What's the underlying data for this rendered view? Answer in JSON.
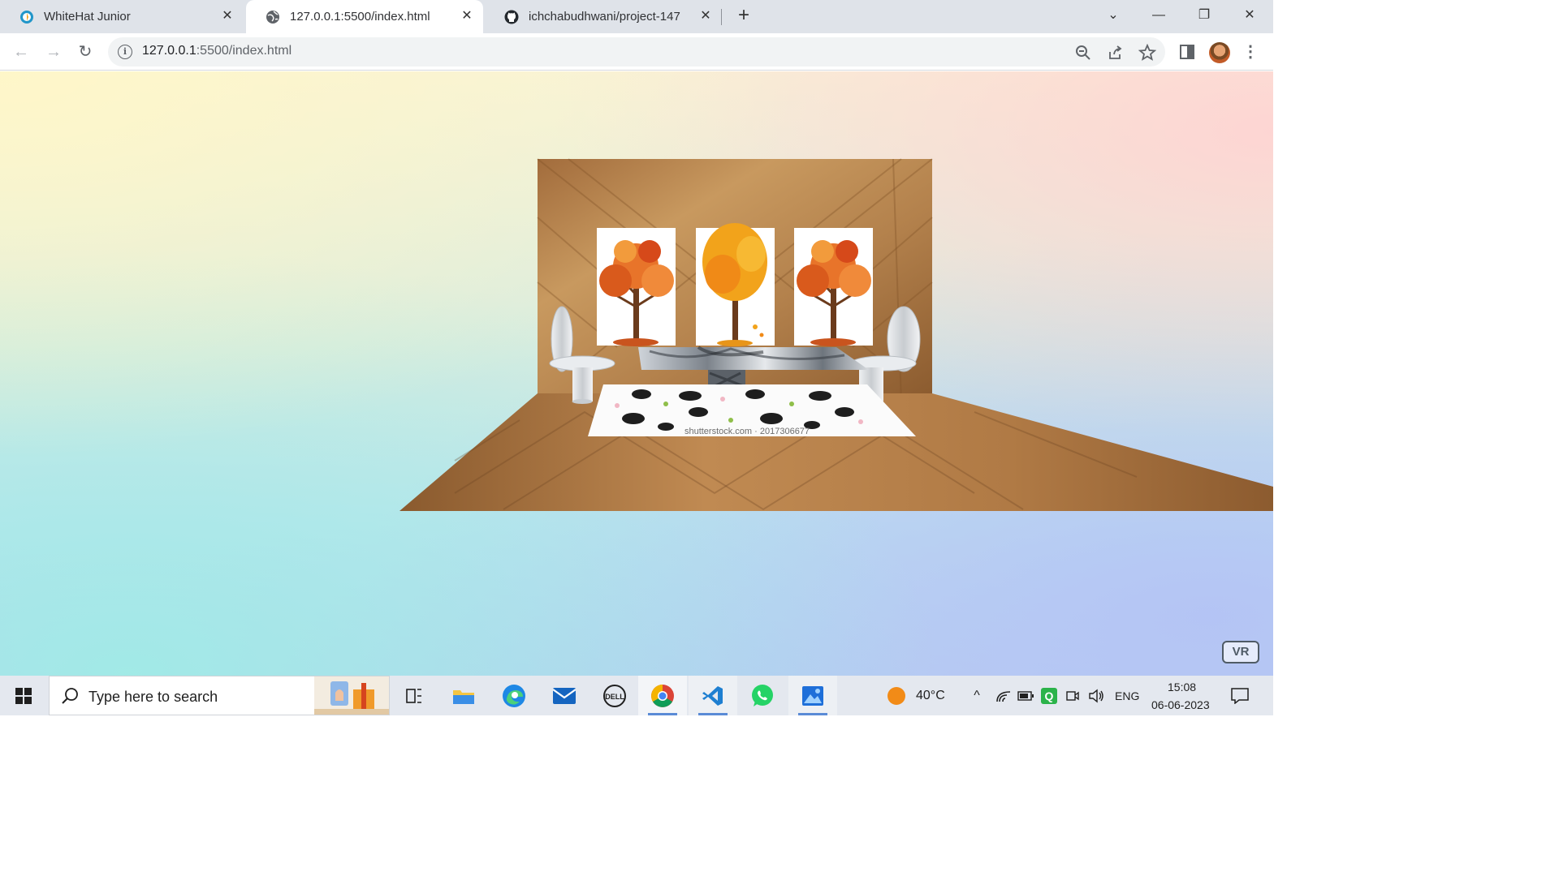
{
  "browser": {
    "tabs": [
      {
        "title": "WhiteHat Junior",
        "icon": "whitehat-icon",
        "active": false
      },
      {
        "title": "127.0.0.1:5500/index.html",
        "icon": "globe-icon",
        "active": true
      },
      {
        "title": "ichchabudhwani/project-147",
        "icon": "github-icon",
        "active": false
      }
    ],
    "address": {
      "host": "127.0.0.1",
      "rest": ":5500/index.html"
    }
  },
  "scene": {
    "vr_label": "VR",
    "rug_caption": "shutterstock.com · 2017306677",
    "colors": {
      "wood": "#b07a45",
      "wood_dark": "#7e4f26",
      "paper": "#ffffff",
      "leaves": "#e8742a",
      "leaves_gold": "#f2a31b",
      "trunk": "#6b3b1c"
    }
  },
  "taskbar": {
    "search_placeholder": "Type here to search",
    "weather": "40°C",
    "language": "ENG",
    "time": "15:08",
    "date": "06-06-2023"
  }
}
